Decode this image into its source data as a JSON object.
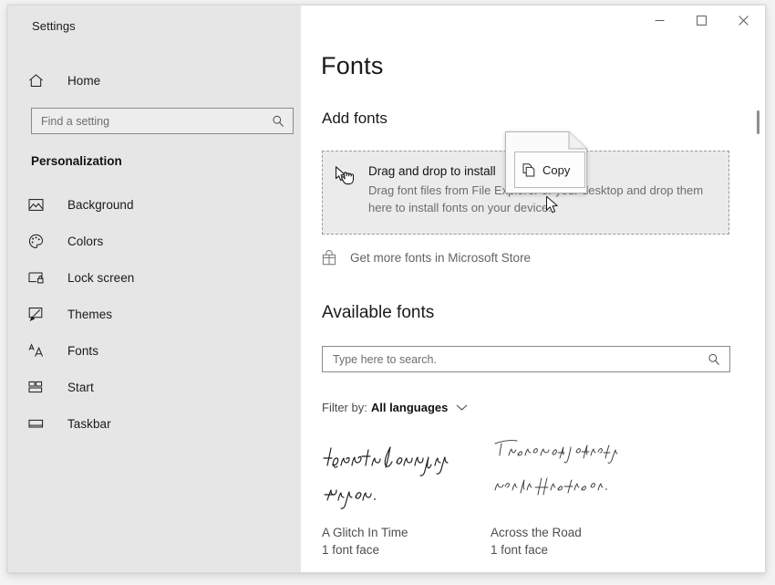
{
  "window": {
    "app_title": "Settings",
    "controls": {
      "minimize_label": "Minimize",
      "maximize_label": "Maximize",
      "close_label": "Close"
    }
  },
  "sidebar": {
    "home_label": "Home",
    "search": {
      "placeholder": "Find a setting",
      "value": ""
    },
    "category_label": "Personalization",
    "items": [
      {
        "label": "Background",
        "icon": "picture-icon",
        "selected": false
      },
      {
        "label": "Colors",
        "icon": "palette-icon",
        "selected": false
      },
      {
        "label": "Lock screen",
        "icon": "lock-screen-icon",
        "selected": false
      },
      {
        "label": "Themes",
        "icon": "brush-icon",
        "selected": false
      },
      {
        "label": "Fonts",
        "icon": "font-icon",
        "selected": true
      },
      {
        "label": "Start",
        "icon": "start-tiles-icon",
        "selected": false
      },
      {
        "label": "Taskbar",
        "icon": "taskbar-icon",
        "selected": false
      }
    ]
  },
  "main": {
    "page_title": "Fonts",
    "add_fonts": {
      "heading": "Add fonts",
      "dropzone_title": "Drag and drop to install",
      "dropzone_subtitle": "Drag font files from File Explorer or your desktop and drop them here to install fonts on your device.",
      "store_link": "Get more fonts in Microsoft Store"
    },
    "available_fonts": {
      "heading": "Available fonts",
      "search_placeholder": "Type here to search.",
      "search_value": "",
      "filter_label": "Filter by:",
      "filter_value": "All languages",
      "cards": [
        {
          "name": "A Glitch In Time",
          "faces": "1 font face",
          "preview_text": "the road to san juan vegas."
        },
        {
          "name": "Across the Road",
          "faces": "1 font face",
          "preview_text": "The aroma of baking bread fills the air."
        }
      ]
    }
  },
  "drag_overlay": {
    "effect_label": "Copy",
    "icon": "copy-icon"
  },
  "colors": {
    "sidebar_bg": "#e6e6e6",
    "content_bg": "#ffffff",
    "dropzone_bg": "#ebebeb",
    "accent_bar": "#767676",
    "muted_text": "#6d6d6d"
  }
}
